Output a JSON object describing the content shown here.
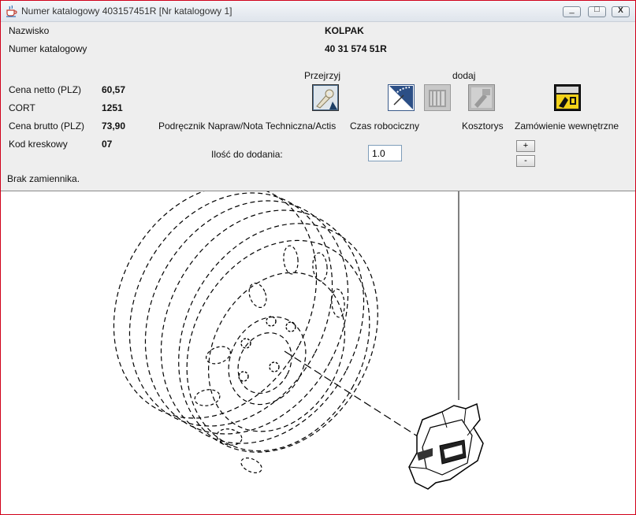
{
  "window": {
    "title": "Numer katalogowy 403157451R [Nr katalogowy 1]",
    "minimize": "_",
    "maximize": "□",
    "close": "X"
  },
  "part": {
    "name_label": "Nazwisko",
    "name_value": "KOLPAK",
    "catalog_label": "Numer katalogowy",
    "catalog_value": "40 31 574 51R"
  },
  "prices": {
    "net_label": "Cena netto (PLZ)",
    "net_value": "60,57",
    "cort_label": "CORT",
    "cort_value": "1251",
    "gross_label": "Cena brutto (PLZ)",
    "gross_value": "73,90",
    "barcode_label": "Kod kreskowy",
    "barcode_value": "07"
  },
  "actions": {
    "browse_header": "Przejrzyj",
    "add_header": "dodaj",
    "manual_label": "Podręcznik Napraw/Nota Techniczna/Actis",
    "labor_label": "Czas robociczny",
    "estimate_label": "Kosztorys",
    "order_label": "Zamówienie wewnętrzne"
  },
  "quantity": {
    "label": "Ilość do dodania:",
    "value": "1.0",
    "plus": "+",
    "minus": "-"
  },
  "status": {
    "no_replacement": "Brak zamiennika."
  },
  "colors": {
    "panel_bg": "#eeeeee",
    "window_border": "#d0001a"
  }
}
